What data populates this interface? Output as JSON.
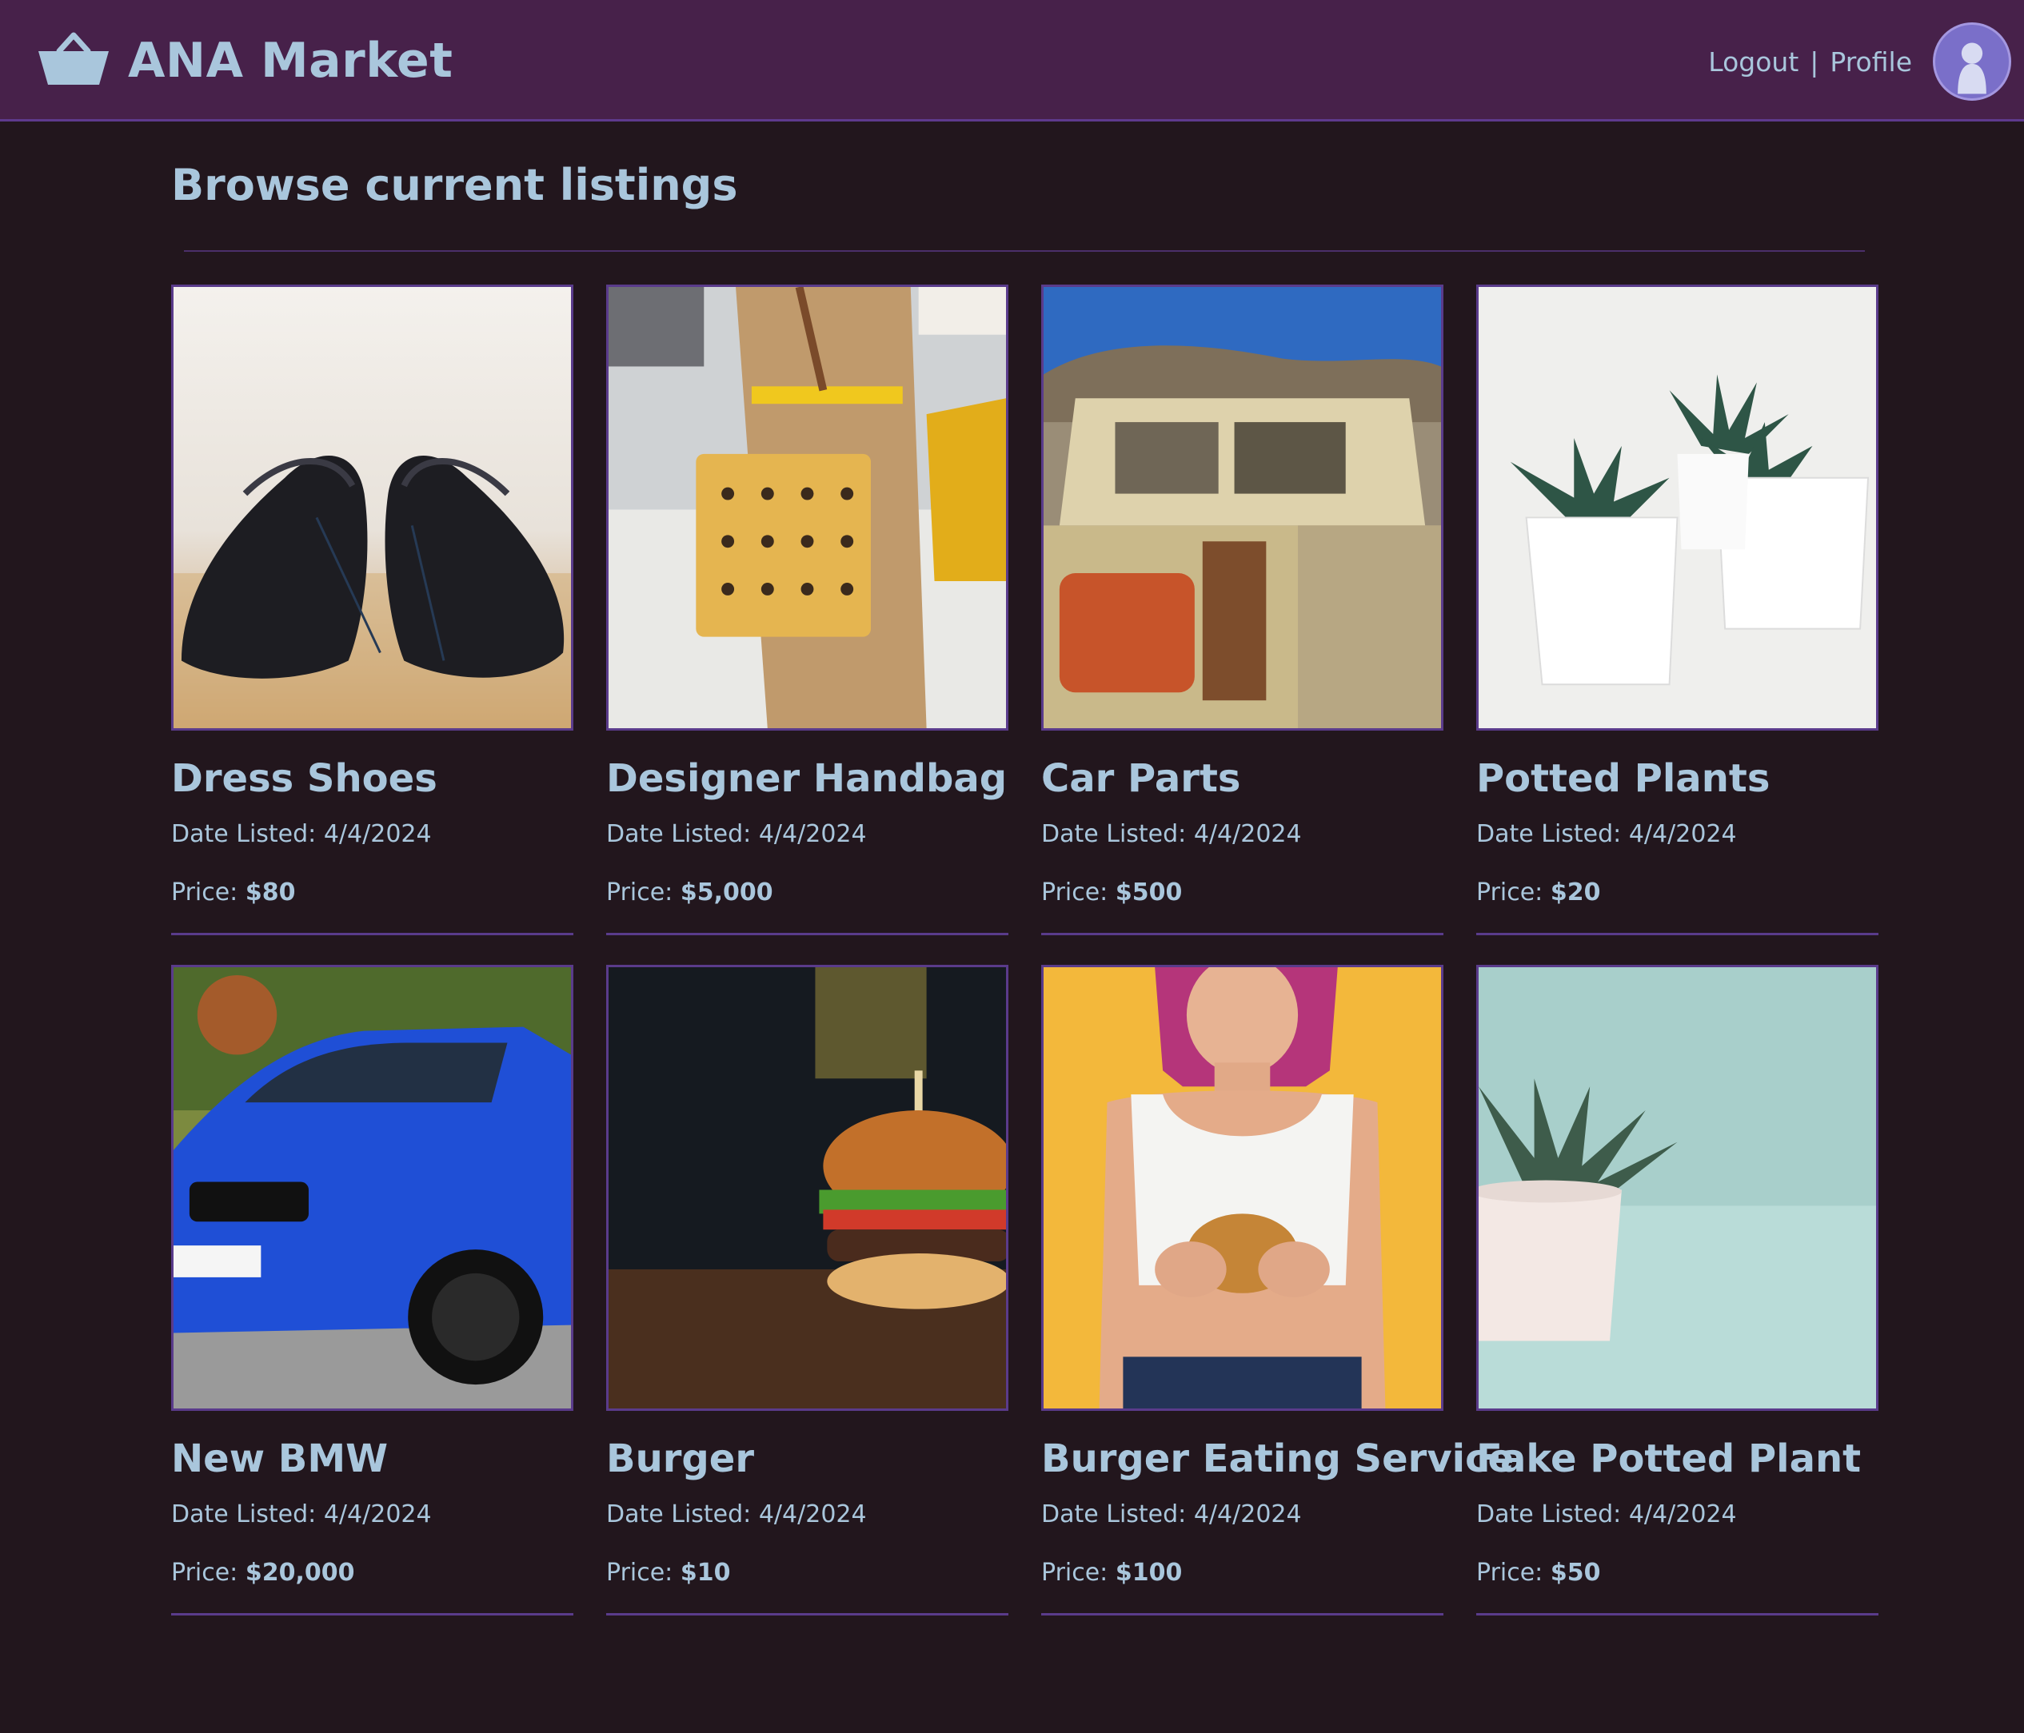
{
  "header": {
    "brand": "ANA Market",
    "logout_label": "Logout",
    "separator": "|",
    "profile_label": "Profile",
    "brand_icon": "basket-icon",
    "avatar_icon": "user-avatar-icon"
  },
  "main": {
    "title": "Browse current listings",
    "date_prefix": "Date Listed:",
    "price_prefix": "Price:",
    "listings": [
      {
        "title": "Dress Shoes",
        "date": "4/4/2024",
        "price": "$80",
        "image": "dress-shoes"
      },
      {
        "title": "Designer Handbag",
        "date": "4/4/2024",
        "price": "$5,000",
        "image": "designer-handbag"
      },
      {
        "title": "Car Parts",
        "date": "4/4/2024",
        "price": "$500",
        "image": "car-parts"
      },
      {
        "title": "Potted Plants",
        "date": "4/4/2024",
        "price": "$20",
        "image": "potted-plants"
      },
      {
        "title": "New BMW",
        "date": "4/4/2024",
        "price": "$20,000",
        "image": "new-bmw"
      },
      {
        "title": "Burger",
        "date": "4/4/2024",
        "price": "$10",
        "image": "burger"
      },
      {
        "title": "Burger Eating Service",
        "date": "4/4/2024",
        "price": "$100",
        "image": "burger-eating-service"
      },
      {
        "title": "Fake Potted Plant",
        "date": "4/4/2024",
        "price": "$50",
        "image": "fake-potted-plant"
      }
    ]
  },
  "colors": {
    "navbar": "#47214a",
    "background": "#22161d",
    "text": "#a9c6dc",
    "border": "#5a3b8b"
  }
}
